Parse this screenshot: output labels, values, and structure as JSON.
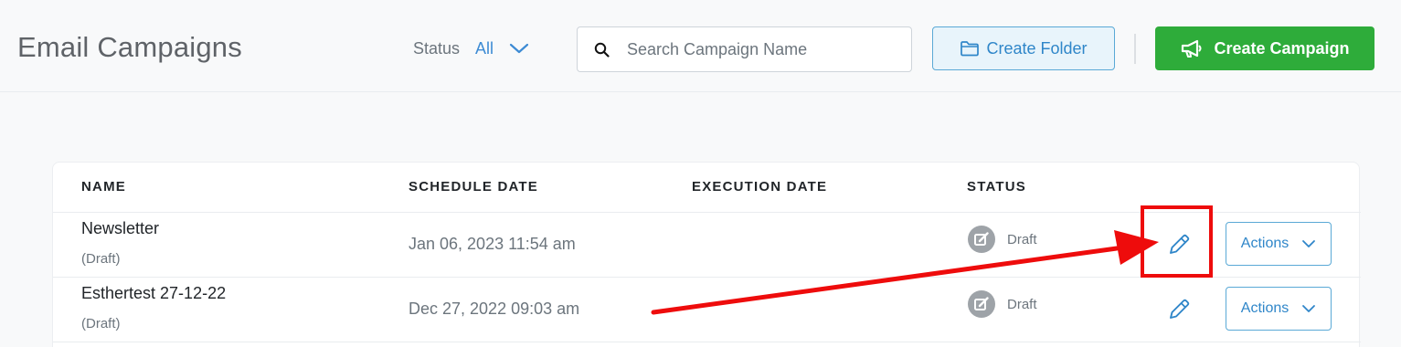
{
  "header": {
    "title": "Email Campaigns",
    "status_label": "Status",
    "status_value": "All",
    "search_placeholder": "Search Campaign Name",
    "create_folder_label": "Create Folder",
    "create_campaign_label": "Create Campaign"
  },
  "table": {
    "columns": [
      "NAME",
      "SCHEDULE DATE",
      "EXECUTION DATE",
      "STATUS"
    ],
    "rows": [
      {
        "name": "Newsletter",
        "sub": "(Draft)",
        "schedule_date": "Jan 06, 2023 11:54 am",
        "execution_date": "",
        "status": "Draft",
        "actions_label": "Actions"
      },
      {
        "name": "Esthertest 27-12-22",
        "sub": "(Draft)",
        "schedule_date": "Dec 27, 2022 09:03 am",
        "execution_date": "",
        "status": "Draft",
        "actions_label": "Actions"
      }
    ]
  },
  "icons": {
    "status_chevron": "chevron-down-icon",
    "search": "search-icon",
    "folder": "folder-icon",
    "megaphone": "megaphone-icon",
    "status_badge": "edit-square-icon",
    "edit": "pencil-icon",
    "actions_chevron": "chevron-down-icon"
  },
  "colors": {
    "primary_blue": "#2f86c9",
    "create_green": "#2eac3a",
    "annotation_red": "#ee0c0c"
  }
}
